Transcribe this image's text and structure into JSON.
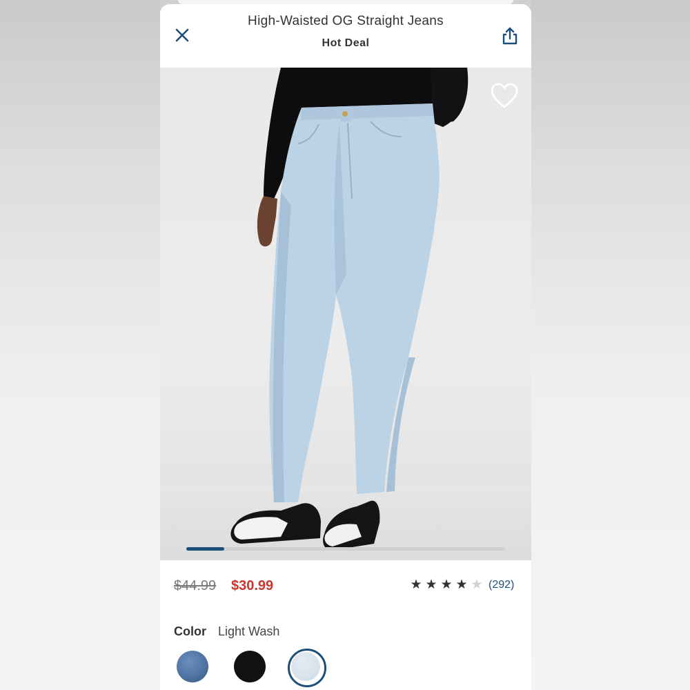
{
  "header": {
    "title": "High-Waisted OG Straight Jeans",
    "subtitle": "Hot Deal",
    "close_icon": "close-icon",
    "share_icon": "share-icon"
  },
  "gallery": {
    "favorite_icon": "heart-outline-icon",
    "current_index_fraction": 0.12
  },
  "pricing": {
    "original_price": "$44.99",
    "sale_price": "$30.99",
    "sale_color": "#c8372d"
  },
  "rating": {
    "stars": 4,
    "max_stars": 5,
    "review_count": "(292)"
  },
  "color": {
    "label": "Color",
    "selected_name": "Light Wash",
    "swatches": [
      {
        "name": "medium-wash",
        "color": "#4f73a3",
        "selected": false
      },
      {
        "name": "black",
        "color": "#111111",
        "selected": false
      },
      {
        "name": "light-wash",
        "color": "#d5e0ea",
        "selected": true
      }
    ]
  },
  "accent": "#1e4f7a"
}
